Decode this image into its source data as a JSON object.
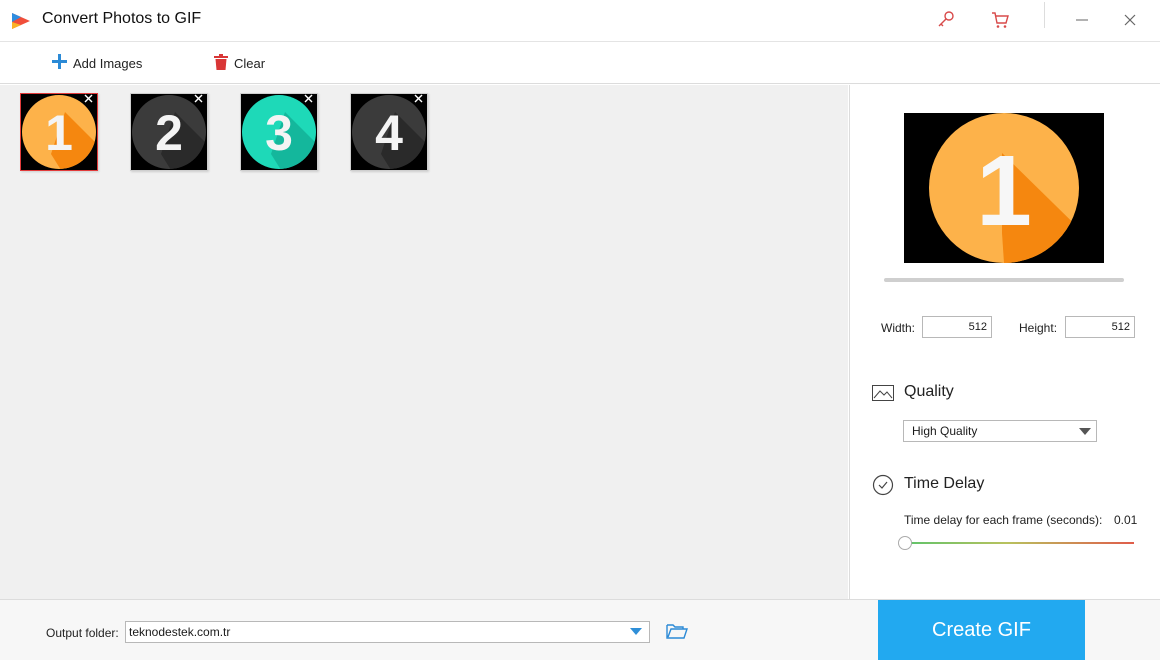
{
  "window": {
    "title": "Convert Photos to GIF",
    "icons": [
      "key-icon",
      "cart-icon",
      "minimize-icon",
      "close-icon"
    ]
  },
  "toolbar": {
    "add_images_label": "Add Images",
    "clear_label": "Clear"
  },
  "thumbnails": [
    {
      "number": "1",
      "color": "#fdb24a",
      "shadow": "#f5870f",
      "selected": true
    },
    {
      "number": "2",
      "color": "#3b3b3b",
      "shadow": "#2a2a2a",
      "selected": false
    },
    {
      "number": "3",
      "color": "#1ed9b8",
      "shadow": "#14b79c",
      "selected": false
    },
    {
      "number": "4",
      "color": "#3b3b3b",
      "shadow": "#2a2a2a",
      "selected": false
    }
  ],
  "settings": {
    "width_label": "Width:",
    "width_value": "512",
    "height_label": "Height:",
    "height_value": "512",
    "quality_title": "Quality",
    "quality_value": "High Quality",
    "delay_title": "Time Delay",
    "delay_label": "Time delay for each frame (seconds):",
    "delay_value": "0.01"
  },
  "bottom": {
    "output_label": "Output folder:",
    "output_value": "teknodestek.com.tr",
    "create_label": "Create GIF"
  },
  "colors": {
    "accent": "#22a9f0",
    "selected_border": "#e23b3b",
    "clear_icon": "#d93636",
    "add_icon": "#2b8ad6"
  }
}
